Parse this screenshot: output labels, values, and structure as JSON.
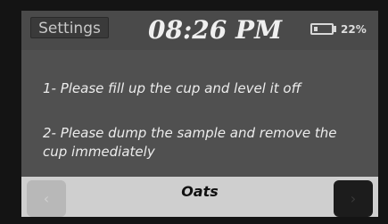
{
  "header": {
    "settings_label": "Settings",
    "time": "08:26 PM",
    "battery_level": 0.22,
    "battery_percent": "22%"
  },
  "instructions": {
    "step1": "1- Please fill up the cup and level it off",
    "step2": "2- Please dump the sample and remove the cup immediately"
  },
  "footer": {
    "product": "Oats",
    "prev_icon": "chevron-left-icon",
    "next_icon": "chevron-right-icon"
  },
  "colors": {
    "screen_bg": "#505050",
    "footer_bg": "#cfcfcf",
    "text": "#ececec"
  }
}
